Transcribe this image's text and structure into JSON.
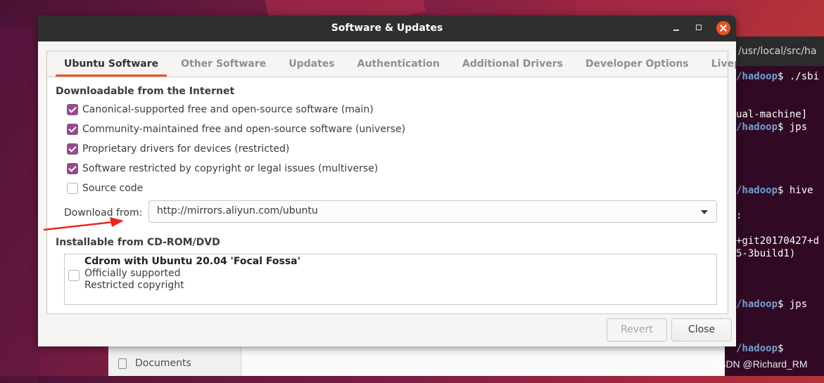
{
  "dialog": {
    "title": "Software & Updates",
    "tabs": [
      {
        "label": "Ubuntu Software",
        "active": true
      },
      {
        "label": "Other Software"
      },
      {
        "label": "Updates"
      },
      {
        "label": "Authentication"
      },
      {
        "label": "Additional Drivers"
      },
      {
        "label": "Developer Options"
      },
      {
        "label": "Livepatch"
      }
    ],
    "internet_section": {
      "title": "Downloadable from the Internet",
      "options": [
        {
          "label": "Canonical-supported free and open-source software (main)",
          "checked": true
        },
        {
          "label": "Community-maintained free and open-source software (universe)",
          "checked": true
        },
        {
          "label": "Proprietary drivers for devices (restricted)",
          "checked": true
        },
        {
          "label": "Software restricted by copyright or legal issues (multiverse)",
          "checked": true
        },
        {
          "label": "Source code",
          "checked": false
        }
      ],
      "download_from_label": "Download from:",
      "download_from_value": "http://mirrors.aliyun.com/ubuntu"
    },
    "cdrom_section": {
      "title": "Installable from CD-ROM/DVD",
      "item": {
        "name": "Cdrom with Ubuntu 20.04 'Focal Fossa'",
        "line2": "Officially supported",
        "line3": "Restricted copyright",
        "checked": false
      }
    },
    "buttons": {
      "revert": "Revert",
      "close": "Close"
    }
  },
  "terminal": {
    "title": ": /usr/local/src/ha",
    "lines": [
      {
        "path": "/hadoop",
        "text": "$ ./sbi"
      },
      {
        "text": "ual-machine]"
      },
      {
        "path": "/hadoop",
        "text": "$ jps"
      },
      {
        "path": "/hadoop",
        "text": "$ hive"
      },
      {
        "text": ":"
      },
      {
        "text": "+git20170427+d"
      },
      {
        "text": "5-3build1)"
      },
      {
        "path": "/hadoop",
        "text": "$ jps"
      },
      {
        "path": "/hadoop",
        "text": "$ "
      }
    ]
  },
  "file_manager": {
    "sidebar_item": "Documents"
  },
  "watermark": "CSDN @Richard_RM",
  "colors": {
    "accent": "#e95420",
    "checkbox": "#924d8b",
    "terminal_bg": "#300a24",
    "titlebar": "#2f2f2f"
  }
}
